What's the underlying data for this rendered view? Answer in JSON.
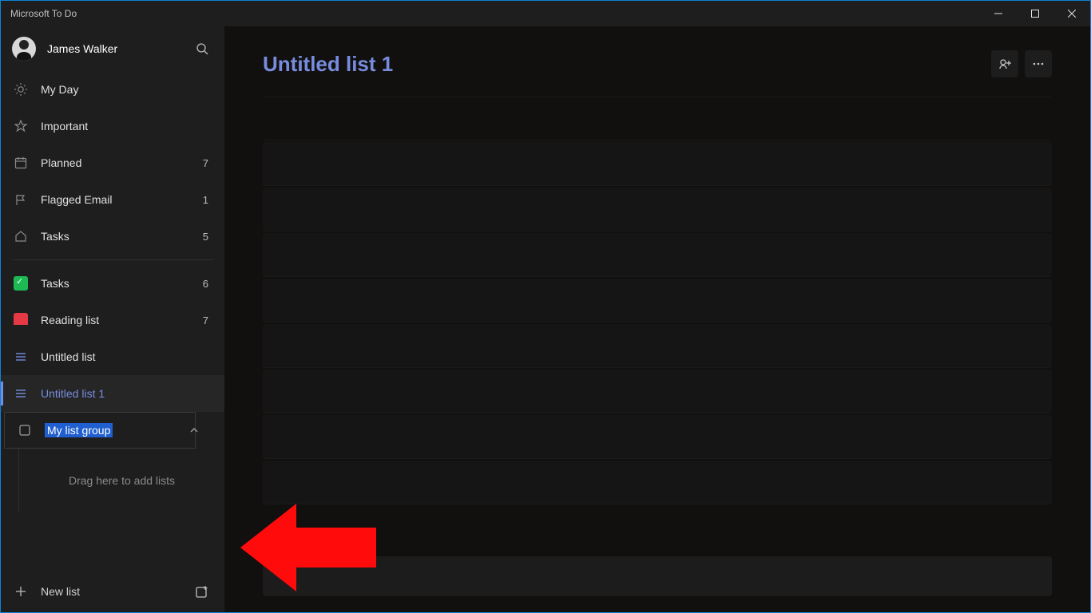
{
  "window": {
    "title": "Microsoft To Do"
  },
  "user": {
    "name": "James Walker"
  },
  "smart_lists": [
    {
      "id": "myday",
      "label": "My Day",
      "count": ""
    },
    {
      "id": "important",
      "label": "Important",
      "count": ""
    },
    {
      "id": "planned",
      "label": "Planned",
      "count": "7"
    },
    {
      "id": "flagged",
      "label": "Flagged Email",
      "count": "1"
    },
    {
      "id": "tasks",
      "label": "Tasks",
      "count": "5"
    }
  ],
  "custom_lists": [
    {
      "id": "tasks2",
      "label": "Tasks",
      "count": "6",
      "color": "green"
    },
    {
      "id": "reading",
      "label": "Reading list",
      "count": "7",
      "color": "red"
    },
    {
      "id": "untitled",
      "label": "Untitled list",
      "count": ""
    },
    {
      "id": "untitled1",
      "label": "Untitled list 1",
      "count": "",
      "active": true
    }
  ],
  "group": {
    "name": "My list group",
    "drop_hint": "Drag here to add lists"
  },
  "footer": {
    "new_list": "New list"
  },
  "main": {
    "title": "Untitled list 1"
  }
}
